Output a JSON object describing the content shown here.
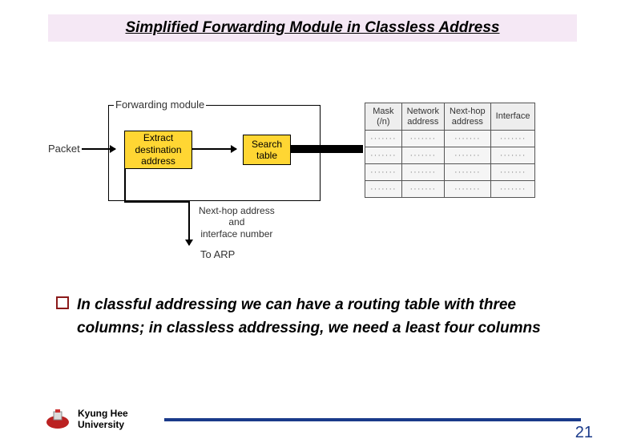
{
  "title": "Simplified Forwarding Module in Classless Address",
  "diagram": {
    "packet_label": "Packet",
    "module_label": "Forwarding module",
    "extract_box": "Extract\ndestination\naddress",
    "search_box": "Search\ntable",
    "nexthop_label": "Next-hop address\nand\ninterface number",
    "to_arp": "To ARP",
    "table": {
      "headers": [
        "Mask\n(/n)",
        "Network\naddress",
        "Next-hop\naddress",
        "Interface"
      ]
    }
  },
  "bullet": "In classful addressing we can have a routing table with three columns; in classless addressing, we need a least four columns",
  "footer": {
    "university": "Kyung Hee University",
    "page": "21"
  }
}
